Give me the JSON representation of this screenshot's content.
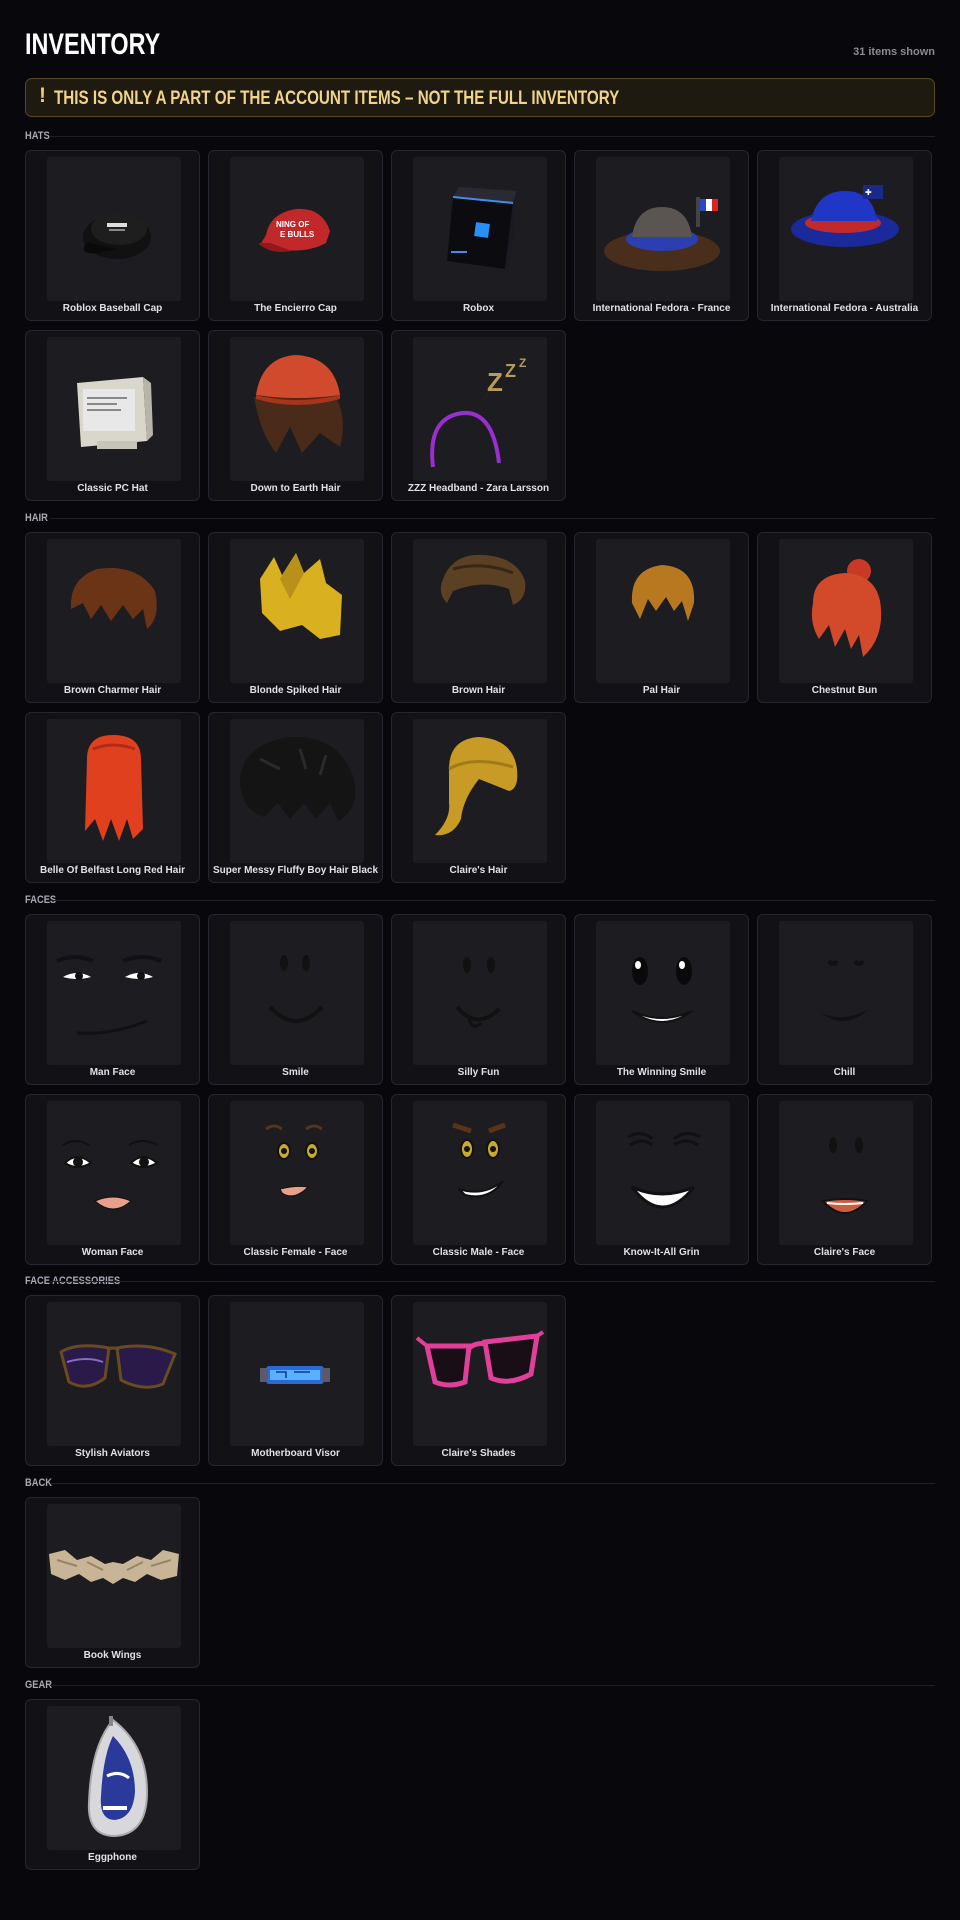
{
  "header": {
    "title": "INVENTORY",
    "count": "31 items shown"
  },
  "banner": {
    "icon": "!",
    "text": "THIS IS ONLY A PART OF THE ACCOUNT ITEMS – NOT THE FULL INVENTORY"
  },
  "sections": [
    {
      "label": "HATS",
      "items": [
        {
          "name": "Roblox Baseball Cap",
          "icon": "baseball-cap"
        },
        {
          "name": "The Encierro Cap",
          "icon": "red-cap"
        },
        {
          "name": "Robox",
          "icon": "robox"
        },
        {
          "name": "International Fedora - France",
          "icon": "fedora-france"
        },
        {
          "name": "International Fedora - Australia",
          "icon": "fedora-australia"
        },
        {
          "name": "Classic PC Hat",
          "icon": "pc-hat"
        },
        {
          "name": "Down to Earth Hair",
          "icon": "down-to-earth-hair"
        },
        {
          "name": "ZZZ Headband - Zara Larsson",
          "icon": "zzz-headband"
        }
      ]
    },
    {
      "label": "HAIR",
      "items": [
        {
          "name": "Brown Charmer Hair",
          "icon": "brown-charmer-hair"
        },
        {
          "name": "Blonde Spiked Hair",
          "icon": "blonde-spiked-hair"
        },
        {
          "name": "Brown Hair",
          "icon": "brown-hair"
        },
        {
          "name": "Pal Hair",
          "icon": "pal-hair"
        },
        {
          "name": "Chestnut Bun",
          "icon": "chestnut-bun"
        },
        {
          "name": "Belle Of Belfast Long Red Hair",
          "icon": "long-red-hair"
        },
        {
          "name": "Super Messy Fluffy Boy Hair Black",
          "icon": "messy-black-hair"
        },
        {
          "name": "Claire's Hair",
          "icon": "claires-hair"
        }
      ]
    },
    {
      "label": "FACES",
      "items": [
        {
          "name": "Man Face",
          "icon": "man-face"
        },
        {
          "name": "Smile",
          "icon": "smile-face"
        },
        {
          "name": "Silly Fun",
          "icon": "silly-fun-face"
        },
        {
          "name": "The Winning Smile",
          "icon": "winning-smile-face"
        },
        {
          "name": "Chill",
          "icon": "chill-face"
        },
        {
          "name": "Woman Face",
          "icon": "woman-face"
        },
        {
          "name": "Classic Female - Face",
          "icon": "classic-female-face"
        },
        {
          "name": "Classic Male - Face",
          "icon": "classic-male-face"
        },
        {
          "name": "Know-It-All Grin",
          "icon": "know-it-all-grin-face"
        },
        {
          "name": "Claire's Face",
          "icon": "claires-face"
        }
      ]
    },
    {
      "label": "FACE ACCESSORIES",
      "items": [
        {
          "name": "Stylish Aviators",
          "icon": "aviators"
        },
        {
          "name": "Motherboard Visor",
          "icon": "motherboard-visor"
        },
        {
          "name": "Claire's Shades",
          "icon": "pink-shades"
        }
      ]
    },
    {
      "label": "BACK",
      "items": [
        {
          "name": "Book Wings",
          "icon": "book-wings"
        }
      ]
    },
    {
      "label": "GEAR",
      "items": [
        {
          "name": "Eggphone",
          "icon": "eggphone"
        }
      ]
    }
  ],
  "colors": {
    "background": "#08080c",
    "card": "#111116",
    "thumb": "#1c1c21",
    "banner_text": "#f2d38a",
    "banner_border": "#5a4a24"
  }
}
